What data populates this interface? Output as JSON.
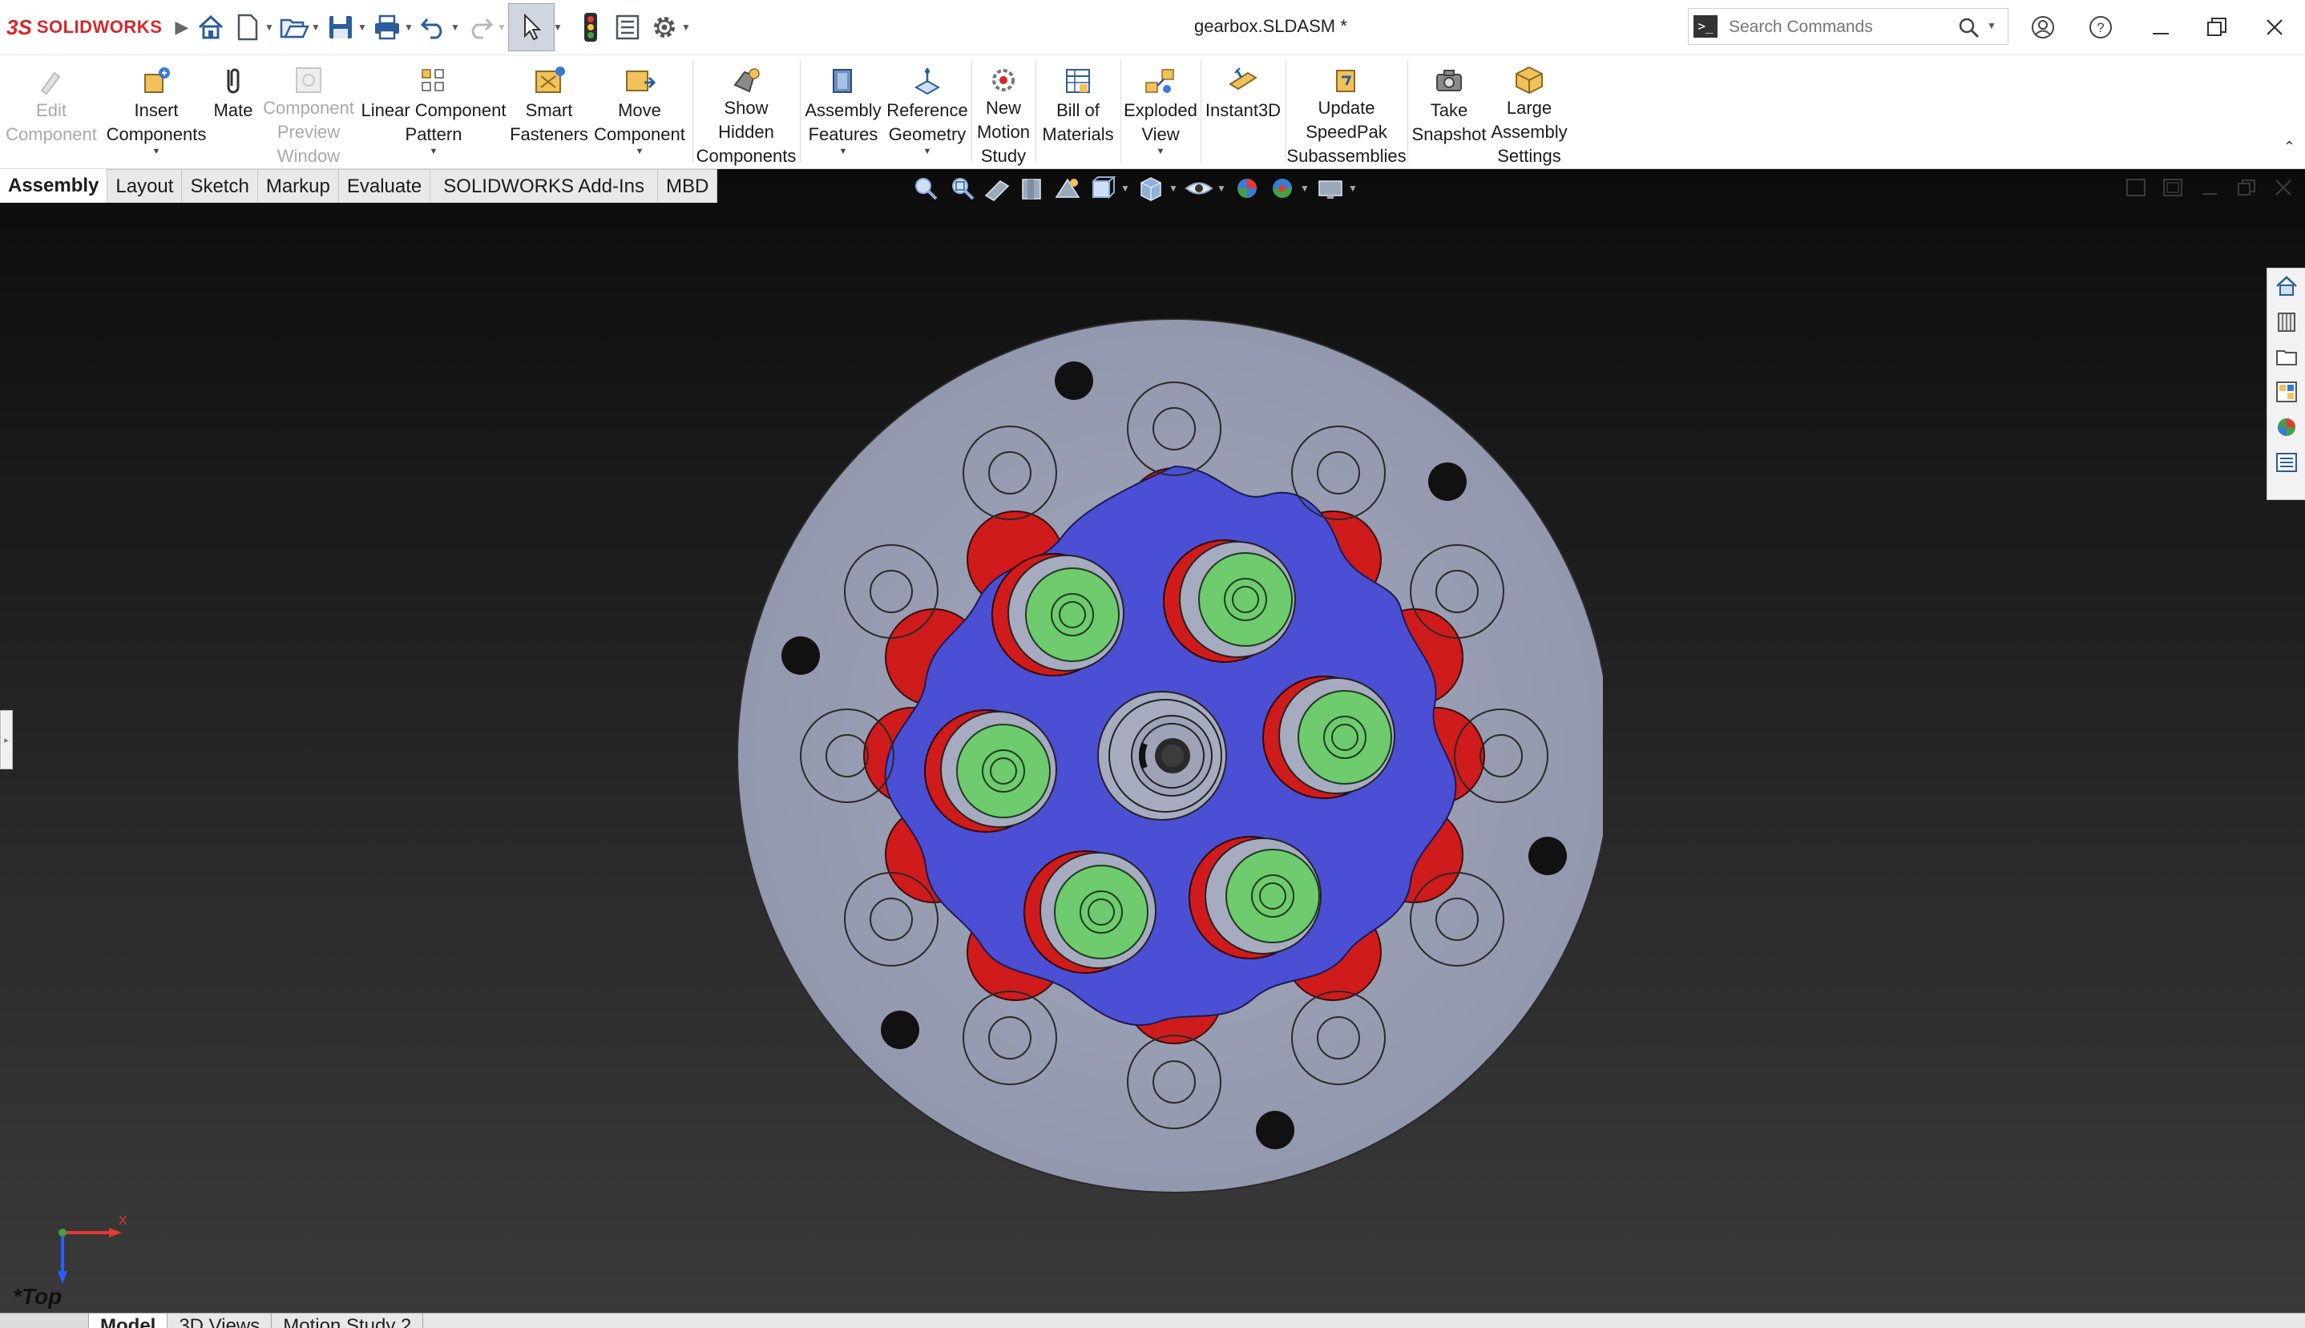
{
  "app": {
    "brand_ds": "3S",
    "brand_name": "SOLIDWORKS"
  },
  "document_title": "gearbox.SLDASM *",
  "search": {
    "placeholder": "Search Commands"
  },
  "ribbon": {
    "edit_component": "Edit\nComponent",
    "insert_components": "Insert\nComponents",
    "mate": "Mate",
    "component_preview": "Component\nPreview\nWindow",
    "linear_pattern": "Linear Component\nPattern",
    "smart_fasteners": "Smart\nFasteners",
    "move_component": "Move\nComponent",
    "show_hidden": "Show\nHidden\nComponents",
    "assembly_features": "Assembly\nFeatures",
    "reference_geometry": "Reference\nGeometry",
    "new_motion_study": "New\nMotion\nStudy",
    "bill_of_materials": "Bill of\nMaterials",
    "exploded_view": "Exploded\nView",
    "instant3d": "Instant3D",
    "update_speedpak": "Update\nSpeedPak\nSubassemblies",
    "take_snapshot": "Take\nSnapshot",
    "large_assembly": "Large\nAssembly\nSettings"
  },
  "tabs": [
    "Assembly",
    "Layout",
    "Sketch",
    "Markup",
    "Evaluate",
    "SOLIDWORKS Add-Ins",
    "MBD"
  ],
  "active_tab": "Assembly",
  "view_orientation": "*Top",
  "triad": {
    "x_label": "X"
  },
  "bottom_tabs": [
    "Model",
    "3D Views",
    "Motion Study 2"
  ],
  "colors": {
    "housing": "#9a9fb3",
    "cycloid_disc": "#4b4fd4",
    "ring_pins": "#cf1b1b",
    "rollers": "#6ecb6e",
    "hole": "#111111"
  },
  "icons": [
    "home-icon",
    "new-file-icon",
    "open-icon",
    "save-icon",
    "print-icon",
    "undo-icon",
    "redo-icon",
    "select-icon",
    "traffic-light-icon",
    "file-properties-icon",
    "options-gear-icon",
    "search-icon",
    "user-icon",
    "help-icon",
    "minimize-icon",
    "restore-icon",
    "close-icon"
  ]
}
